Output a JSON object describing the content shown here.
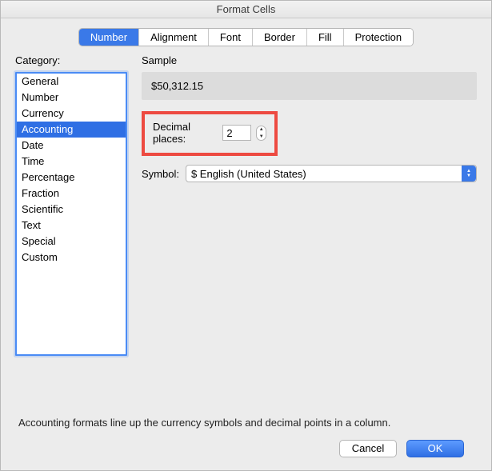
{
  "title": "Format Cells",
  "tabs": [
    {
      "label": "Number",
      "active": true
    },
    {
      "label": "Alignment",
      "active": false
    },
    {
      "label": "Font",
      "active": false
    },
    {
      "label": "Border",
      "active": false
    },
    {
      "label": "Fill",
      "active": false
    },
    {
      "label": "Protection",
      "active": false
    }
  ],
  "category": {
    "label": "Category:",
    "items": [
      "General",
      "Number",
      "Currency",
      "Accounting",
      "Date",
      "Time",
      "Percentage",
      "Fraction",
      "Scientific",
      "Text",
      "Special",
      "Custom"
    ],
    "selected": "Accounting"
  },
  "sample": {
    "label": "Sample",
    "value": "$50,312.15"
  },
  "decimal": {
    "label": "Decimal places:",
    "value": "2"
  },
  "symbol": {
    "label": "Symbol:",
    "value": "$ English (United States)"
  },
  "description": "Accounting formats line up the currency symbols and decimal points in a column.",
  "buttons": {
    "cancel": "Cancel",
    "ok": "OK"
  }
}
